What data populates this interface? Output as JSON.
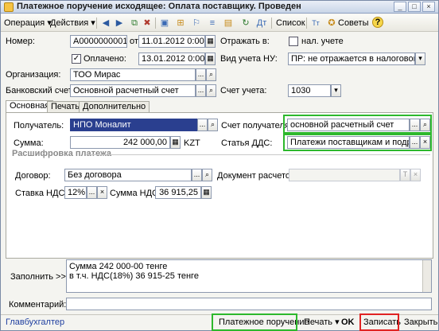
{
  "window": {
    "title": "Платежное поручение исходящее: Оплата поставщику. Проведен",
    "buttons": [
      "_",
      "□",
      "×"
    ]
  },
  "toolbar": {
    "operation": "Операция ▾",
    "actions": "Действия ▾",
    "list": "Список",
    "tips": "Советы",
    "help": "?"
  },
  "form": {
    "number_label": "Номер:",
    "number_value": "А0000000001",
    "from_label": "от",
    "date_value": "11.01.2012 0:00:00",
    "paid_label": "Оплачено:",
    "paid_checked": "✓",
    "paid_date": "13.01.2012 0:00:00",
    "reflect_label": "Отражать в:",
    "tax_label": "нал. учете",
    "nu_label": "Вид учета НУ:",
    "nu_value": "ПР: не отражается в налоговом учет",
    "org_label": "Организация:",
    "org_value": "ТОО Мирас",
    "bank_label": "Банковский счет:",
    "bank_value": "Основной расчетный счет",
    "account_label": "Счет учета:",
    "account_value": "1030"
  },
  "tabs": [
    "Основная",
    "Печать",
    "Дополнительно"
  ],
  "main": {
    "recipient_label": "Получатель:",
    "recipient_value": "НПО Моналит",
    "recipient_account_label": "Счет получателя:",
    "recipient_account_value": "основной расчетный счет",
    "sum_label": "Сумма:",
    "sum_value": "242 000,00",
    "currency": "KZT",
    "dds_label": "Статья ДДС:",
    "dds_value": "Платежи поставщикам и подрядчи",
    "breakdown_label": "Расшифровка платежа",
    "contract_label": "Договор:",
    "contract_value": "Без договора",
    "settlement_label": "Документ расчетов:",
    "vat_rate_label": "Ставка НДС:",
    "vat_rate_value": "12%",
    "vat_sum_label": "Сумма НДС:",
    "vat_sum_value": "36 915,25"
  },
  "fill": {
    "label": "Заполнить >>",
    "line1": "Сумма 242 000-00  тенге",
    "line2": "в т.ч. НДС(18%) 36 915-25 тенге"
  },
  "comment_label": "Комментарий:",
  "bottom": {
    "accountant": "Главбухгалтер",
    "payment_order": "Платежное поручение",
    "print": "Печать ▾",
    "ok": "OK",
    "save": "Записать",
    "close": "Закрыть"
  },
  "icons": {
    "ellipsis": "...",
    "search": "🔍",
    "clear": "×",
    "calendar": "▦",
    "dropdown": "▾"
  }
}
